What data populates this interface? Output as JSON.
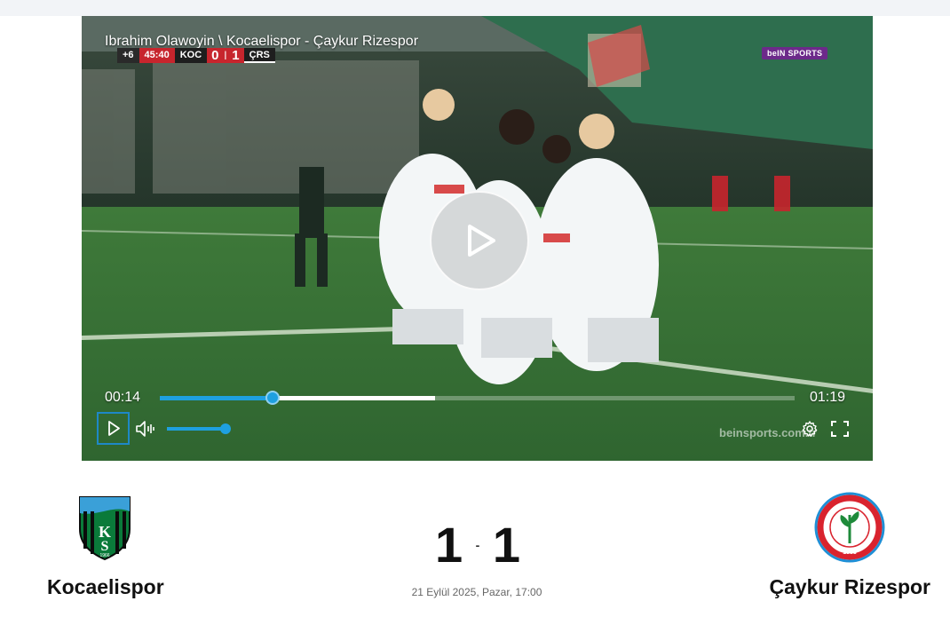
{
  "video": {
    "title": "Ibrahim Olawoyin \\ Kocaelispor - Çaykur Rizespor",
    "current_time": "00:14",
    "duration": "01:19",
    "progress_fraction": 0.177,
    "buffered_fraction": 0.433,
    "volume_fraction": 1.0,
    "watermark": "beinsports.com.tr",
    "broadcaster_badge": "beIN SPORTS",
    "scorebug": {
      "added_time": "+6",
      "clock": "45:40",
      "home_abbr": "KOC",
      "home_score": "0",
      "away_score": "1",
      "away_abbr": "ÇRS"
    },
    "icons": {
      "big_play": "play-icon",
      "play": "play-icon",
      "volume": "volume-icon",
      "settings": "gear-icon",
      "fullscreen": "fullscreen-icon"
    },
    "colors": {
      "accent": "#1ea0e0",
      "scorebug_red": "#c7252d"
    }
  },
  "match": {
    "home_team": "Kocaelispor",
    "away_team": "Çaykur Rizespor",
    "home_score": "1",
    "away_score": "1",
    "separator": "-",
    "datetime": "21 Eylül 2025, Pazar, 17:00",
    "home_logo_text": "KS",
    "home_logo_year": "1966",
    "away_logo_text": "ÇAYKUR RİZESPOR KULÜBÜ",
    "away_logo_year": "1953",
    "colors": {
      "home_green": "#0a7a3a",
      "away_blue": "#1f8fd6",
      "away_red": "#d9232e"
    }
  }
}
